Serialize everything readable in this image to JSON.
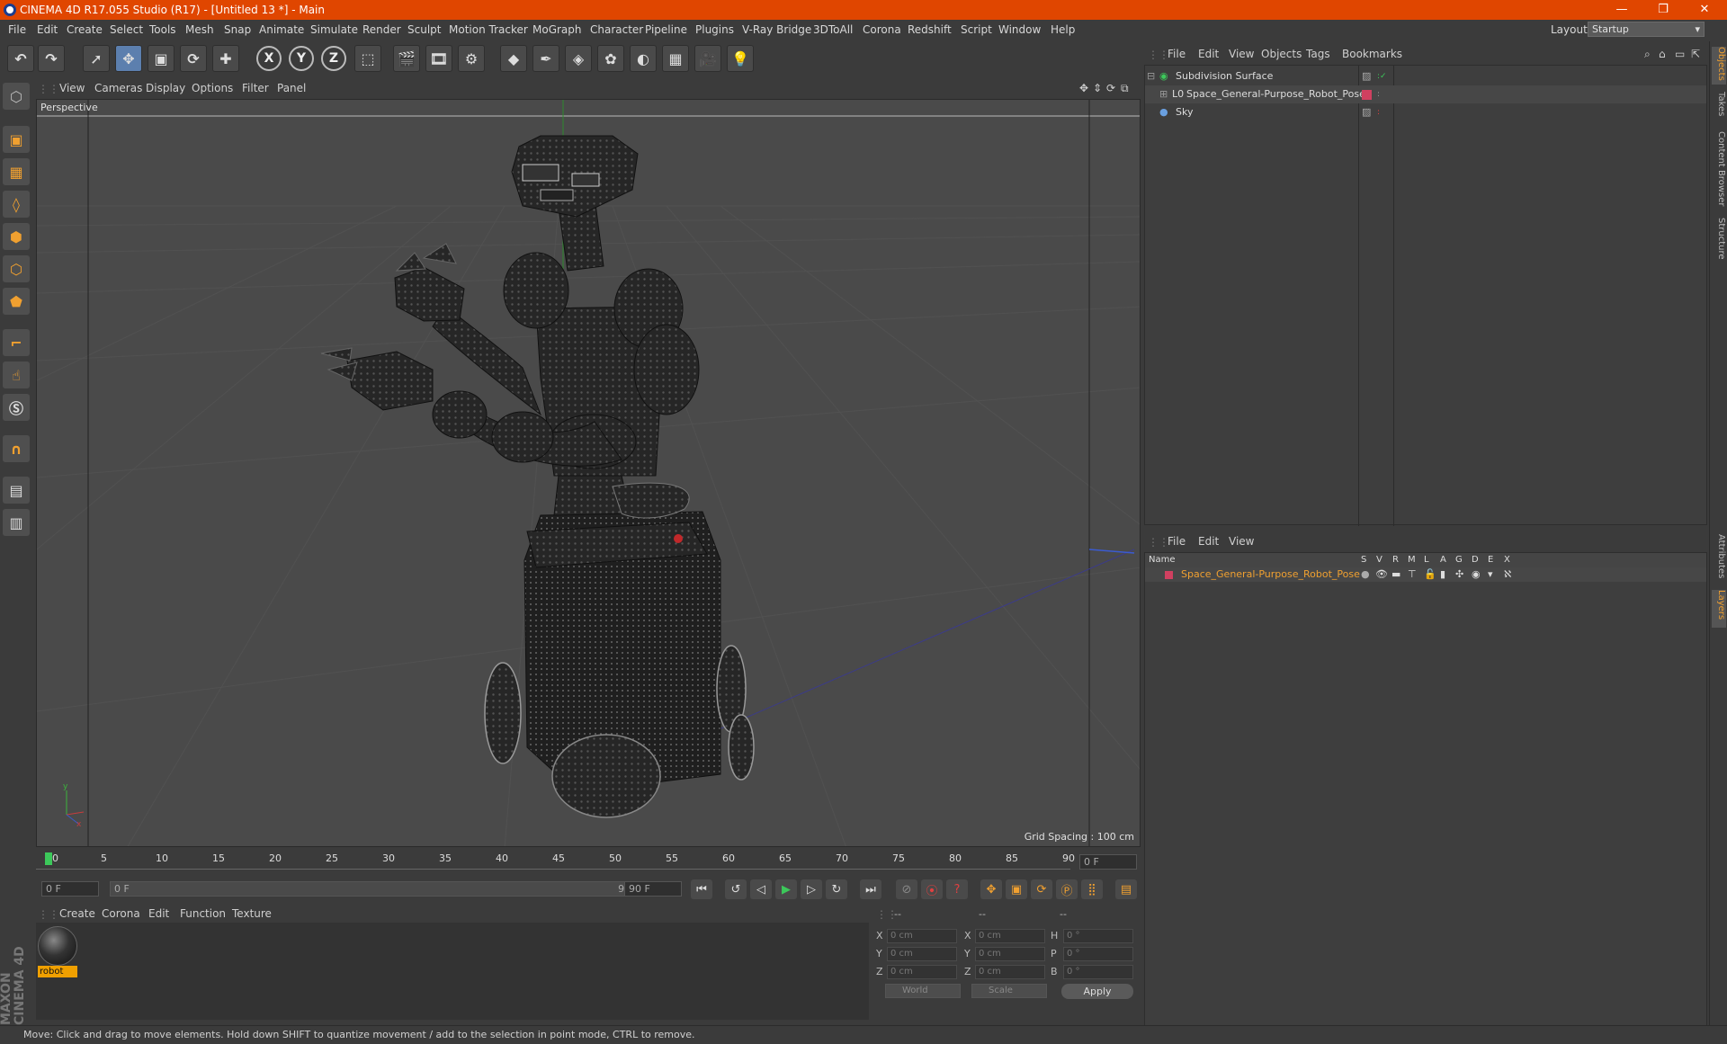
{
  "window": {
    "title": "CINEMA 4D R17.055 Studio (R17) - [Untitled 13 *] - Main",
    "minimize": "—",
    "restore": "❐",
    "close": "✕"
  },
  "menu": [
    "File",
    "Edit",
    "Create",
    "Select",
    "Tools",
    "Mesh",
    "Snap",
    "Animate",
    "Simulate",
    "Render",
    "Sculpt",
    "Motion Tracker",
    "MoGraph",
    "Character",
    "Pipeline",
    "Plugins",
    "V-Ray Bridge",
    "3DToAll",
    "Corona",
    "Redshift",
    "Script",
    "Window",
    "Help"
  ],
  "layout": {
    "label": "Layout:",
    "value": "Startup"
  },
  "toolbar": {
    "x_label": "X",
    "y_label": "Y",
    "z_label": "Z"
  },
  "viewport": {
    "menu": [
      "View",
      "Cameras",
      "Display",
      "Options",
      "Filter",
      "Panel"
    ],
    "label": "Perspective",
    "grid_spacing": "Grid Spacing : 100 cm"
  },
  "timeline": {
    "ticks": [
      "0",
      "5",
      "10",
      "15",
      "20",
      "25",
      "30",
      "35",
      "40",
      "45",
      "50",
      "55",
      "60",
      "65",
      "70",
      "75",
      "80",
      "85",
      "90"
    ],
    "current_frame": "0 F",
    "start_field": "0 F",
    "slider_start": "0 F",
    "slider_end": "90 F",
    "end_field": "90 F"
  },
  "material_manager": {
    "menu": [
      "Create",
      "Corona",
      "Edit",
      "Function",
      "Texture"
    ],
    "material_name": "robot"
  },
  "coordinates": {
    "headers": [
      "--",
      "--",
      "--"
    ],
    "rows": [
      {
        "axis1": "X",
        "v1": "0 cm",
        "axis2": "X",
        "v2": "0 cm",
        "axis3": "H",
        "v3": "0 °"
      },
      {
        "axis1": "Y",
        "v1": "0 cm",
        "axis2": "Y",
        "v2": "0 cm",
        "axis3": "P",
        "v3": "0 °"
      },
      {
        "axis1": "Z",
        "v1": "0 cm",
        "axis2": "Z",
        "v2": "0 cm",
        "axis3": "B",
        "v3": "0 °"
      }
    ],
    "mode": "World",
    "scale": "Scale",
    "apply": "Apply"
  },
  "object_manager": {
    "menu": [
      "File",
      "Edit",
      "View",
      "Objects",
      "Tags",
      "Bookmarks"
    ],
    "objects": [
      {
        "name": "Subdivision Surface"
      },
      {
        "name": "Space_General-Purpose_Robot_Pose"
      },
      {
        "name": "Sky"
      }
    ]
  },
  "layer_manager": {
    "menu": [
      "File",
      "Edit",
      "View"
    ],
    "columns": [
      "Name",
      "S",
      "V",
      "R",
      "M",
      "L",
      "A",
      "G",
      "D",
      "E",
      "X"
    ],
    "layer_name": "Space_General-Purpose_Robot_Pose"
  },
  "right_tabs": [
    "Objects",
    "Takes",
    "Content Browser",
    "Structure",
    "Attributes",
    "Layers"
  ],
  "status": "Move: Click and drag to move elements. Hold down SHIFT to quantize movement / add to the selection in point mode, CTRL to remove.",
  "logo": "MAXON CINEMA 4D"
}
